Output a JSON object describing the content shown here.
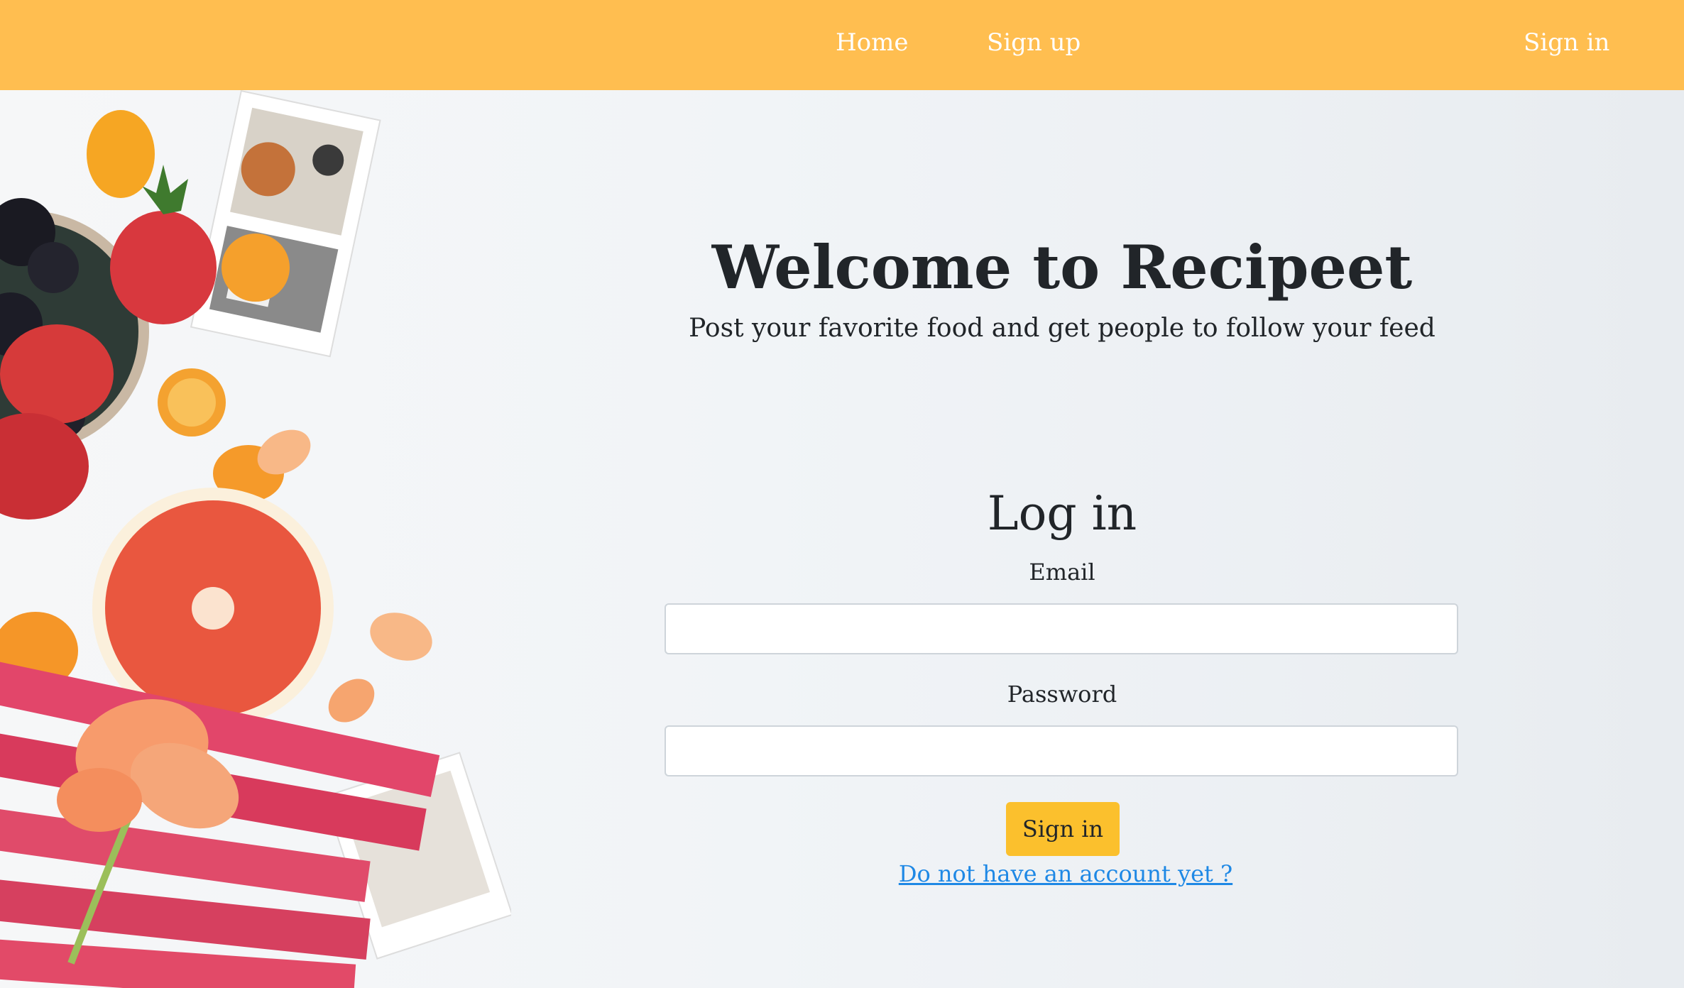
{
  "navbar": {
    "links": [
      "Home",
      "Sign up",
      "Sign in"
    ]
  },
  "hero": {
    "title": "Welcome to Recipeet",
    "subtitle": "Post your favorite food and get people to follow your feed"
  },
  "login": {
    "heading": "Log in",
    "email_label": "Email",
    "email_value": "",
    "password_label": "Password",
    "password_value": "",
    "submit_label": "Sign in",
    "signup_link": "Do not have an account yet ?"
  },
  "colors": {
    "navbar": "#ffbe50",
    "button": "#fbc02d",
    "link": "#1e88e5"
  }
}
